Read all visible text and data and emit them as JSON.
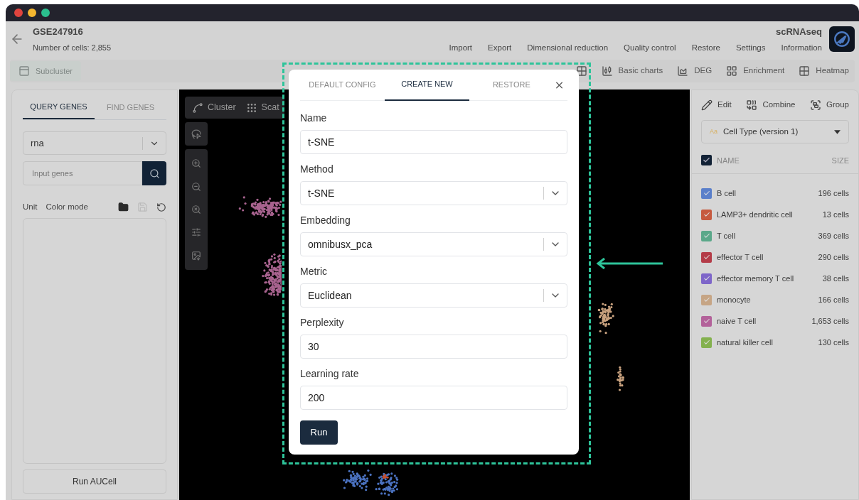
{
  "window": {
    "title": "GSE247916",
    "subtitle": "Number of cells: 2,855",
    "app_name": "scRNAseq"
  },
  "menu": [
    "Import",
    "Export",
    "Dimensional reduction",
    "Quality control",
    "Restore",
    "Settings",
    "Information"
  ],
  "toolbar": {
    "left": [
      {
        "label": "Subcluster",
        "kind": "subcluster",
        "disabled": true
      }
    ],
    "right": [
      {
        "kind": "composition",
        "disabled": false
      },
      {
        "label": "Basic charts",
        "kind": "charts",
        "disabled": false
      },
      {
        "label": "DEG",
        "kind": "deg",
        "disabled": false
      },
      {
        "label": "Enrichment",
        "kind": "enrichment",
        "disabled": false
      },
      {
        "label": "Heatmap",
        "kind": "heatmap",
        "disabled": false
      }
    ]
  },
  "left_panel": {
    "tabs": [
      {
        "label": "QUERY GENES",
        "selected": true
      },
      {
        "label": "FIND GENES",
        "selected": false
      }
    ],
    "assay_select": {
      "value": "rna"
    },
    "gene_search": {
      "placeholder": "Input genes"
    },
    "options": [
      "Unit",
      "Color mode"
    ],
    "run_button": "Run AUCell"
  },
  "canvas": {
    "toolbar": [
      {
        "label": "Cluster",
        "kind": "cluster"
      },
      {
        "label": "Scat",
        "kind": "scatter"
      }
    ]
  },
  "right_panel": {
    "actions": [
      {
        "label": "Edit",
        "kind": "edit"
      },
      {
        "label": "Combine",
        "kind": "combine"
      },
      {
        "label": "Group",
        "kind": "group"
      }
    ],
    "annotation_select": {
      "badge": "Aa",
      "value": "Cell Type (version 1)"
    },
    "header": {
      "checked": true,
      "columns": [
        "NAME",
        "SIZE"
      ]
    },
    "cell_types": [
      {
        "name": "B cell",
        "size": "196 cells",
        "color": "#5a7fca",
        "checked": true
      },
      {
        "name": "LAMP3+ dendritic cell",
        "size": "13 cells",
        "color": "#c65a3f",
        "checked": true
      },
      {
        "name": "T cell",
        "size": "369 cells",
        "color": "#5ba88a",
        "checked": true
      },
      {
        "name": "effector T cell",
        "size": "290 cells",
        "color": "#b43c48",
        "checked": true
      },
      {
        "name": "effector memory T cell",
        "size": "38 cells",
        "color": "#7e66c9",
        "checked": true
      },
      {
        "name": "monocyte",
        "size": "166 cells",
        "color": "#c6a585",
        "checked": true
      },
      {
        "name": "naive T cell",
        "size": "1,653 cells",
        "color": "#b3629a",
        "checked": true
      },
      {
        "name": "natural killer cell",
        "size": "130 cells",
        "color": "#84b14f",
        "checked": true
      }
    ]
  },
  "modal": {
    "tabs": [
      {
        "label": "DEFAULT CONFIG",
        "selected": false
      },
      {
        "label": "CREATE NEW",
        "selected": true
      },
      {
        "label": "RESTORE",
        "selected": false
      }
    ],
    "fields": [
      {
        "label": "Name",
        "value": "t-SNE",
        "kind": "input"
      },
      {
        "label": "Method",
        "value": "t-SNE",
        "kind": "select"
      },
      {
        "label": "Embedding",
        "value": "omnibusx_pca",
        "kind": "select"
      },
      {
        "label": "Metric",
        "value": "Euclidean",
        "kind": "select"
      },
      {
        "label": "Perplexity",
        "value": "30",
        "kind": "input"
      },
      {
        "label": "Learning rate",
        "value": "200",
        "kind": "input"
      }
    ],
    "run_button": "Run"
  }
}
